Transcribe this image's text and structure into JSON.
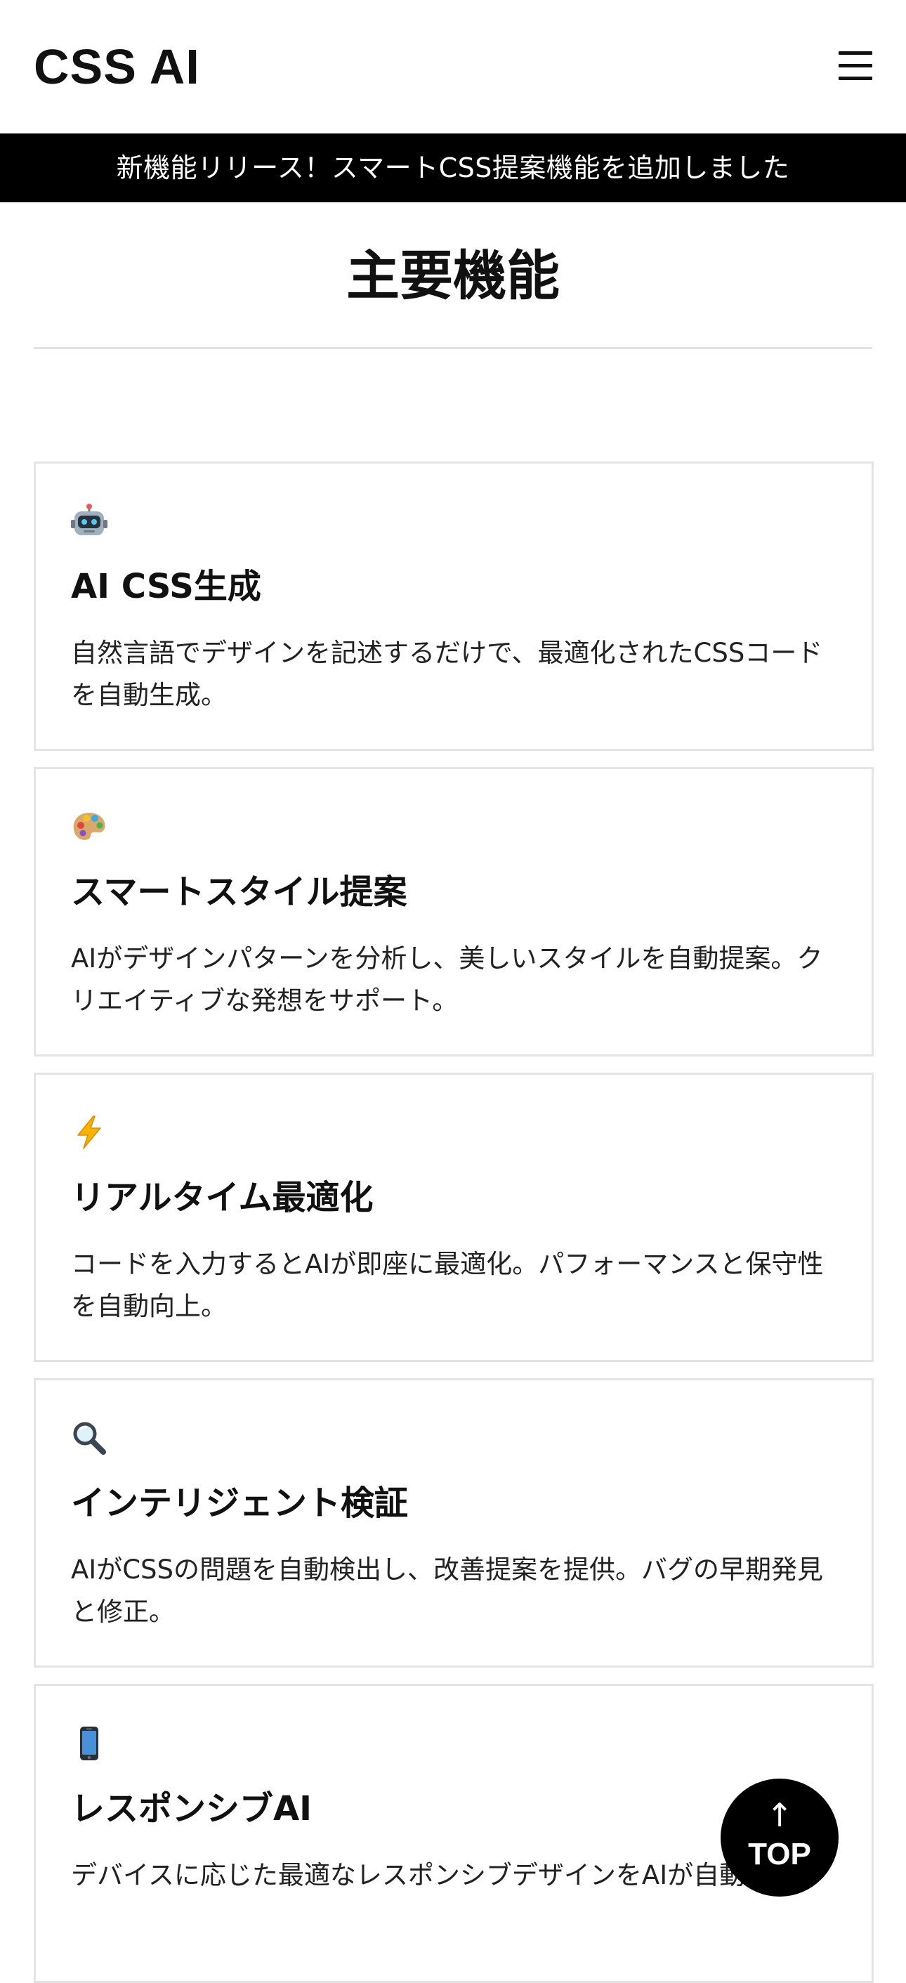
{
  "header": {
    "logo": "CSS AI",
    "menu_icon": "hamburger-menu-icon"
  },
  "announcement": {
    "text": "新機能リリース！スマートCSS提案機能を追加しました"
  },
  "features": {
    "title": "主要機能",
    "items": [
      {
        "icon": "robot-icon",
        "title": "AI CSS生成",
        "description": "自然言語でデザインを記述するだけで、最適化されたCSSコードを自動生成。"
      },
      {
        "icon": "artist-palette-icon",
        "title": "スマートスタイル提案",
        "description": "AIがデザインパターンを分析し、美しいスタイルを自動提案。クリエイティブな発想をサポート。"
      },
      {
        "icon": "lightning-icon",
        "title": "リアルタイム最適化",
        "description": "コードを入力するとAIが即座に最適化。パフォーマンスと保守性を自動向上。"
      },
      {
        "icon": "magnifier-icon",
        "title": "インテリジェント検証",
        "description": "AIがCSSの問題を自動検出し、改善提案を提供。バグの早期発見と修正。"
      },
      {
        "icon": "mobile-phone-icon",
        "title": "レスポンシブAI",
        "description": "デバイスに応じた最適なレスポンシブデザインをAIが自動生成。"
      }
    ]
  },
  "scroll_top": {
    "arrow": "↑",
    "label": "TOP"
  }
}
